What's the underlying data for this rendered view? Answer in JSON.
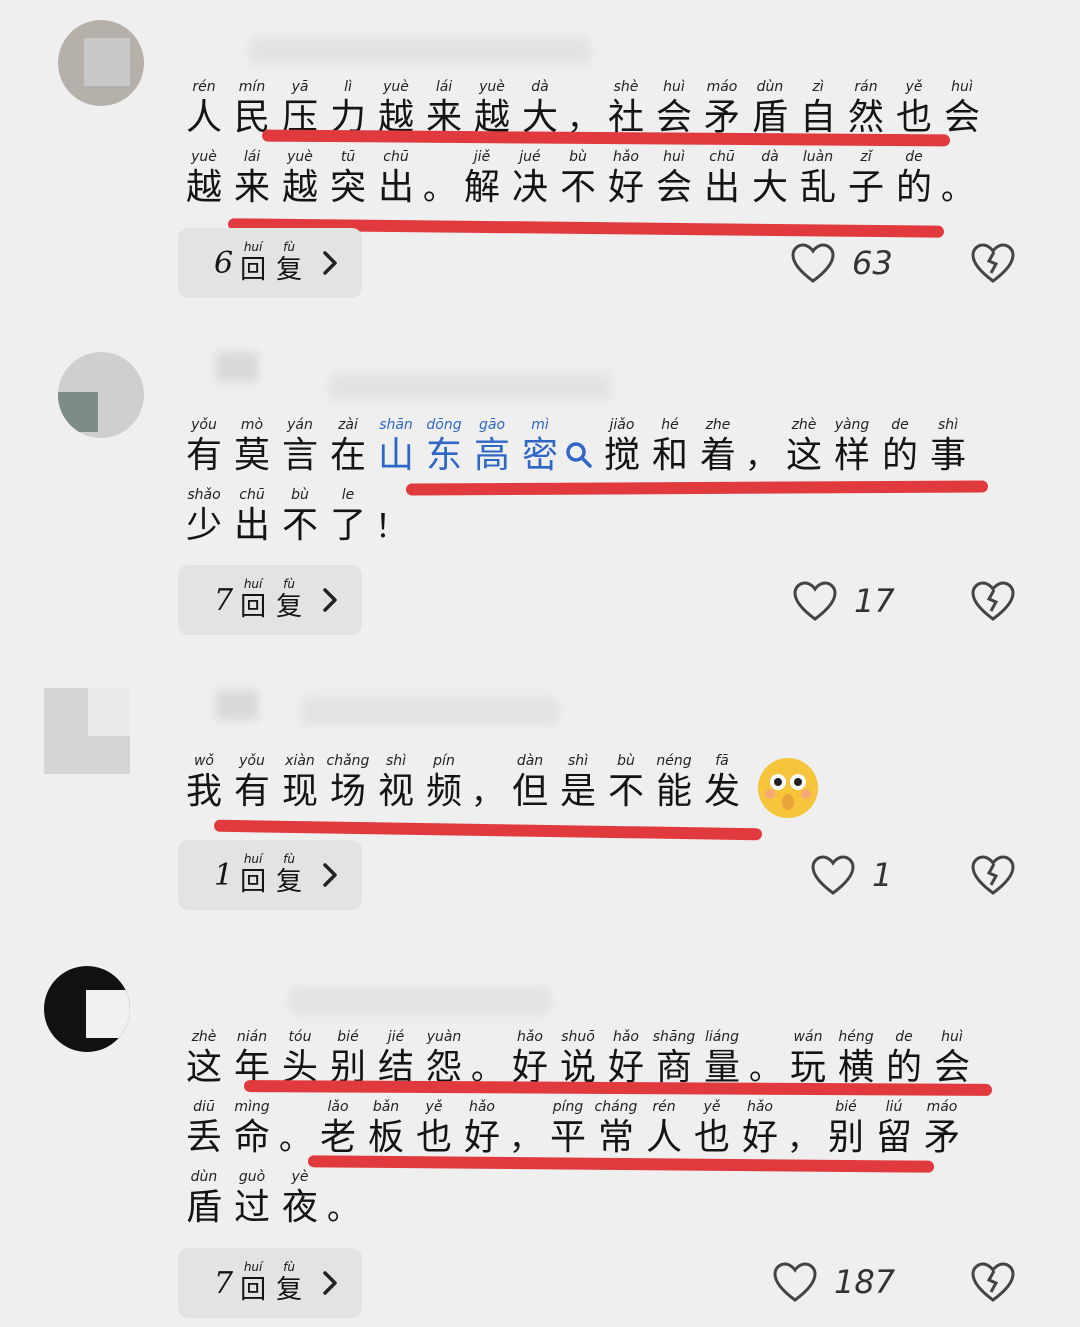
{
  "colors": {
    "background": "#efefef",
    "underline": "#e03a3e",
    "link": "#2f67c6",
    "reply_bg": "#e3e3e3"
  },
  "comments": [
    {
      "lines": [
        [
          [
            "人",
            "rén"
          ],
          [
            "民",
            "mín"
          ],
          [
            "压",
            "yā"
          ],
          [
            "力",
            "lì"
          ],
          [
            "越",
            "yuè"
          ],
          [
            "来",
            "lái"
          ],
          [
            "越",
            "yuè"
          ],
          [
            "大",
            "dà"
          ],
          [
            "，",
            ""
          ],
          [
            "社",
            "shè"
          ],
          [
            "会",
            "huì"
          ],
          [
            "矛",
            "máo"
          ],
          [
            "盾",
            "dùn"
          ],
          [
            "自",
            "zì"
          ],
          [
            "然",
            "rán"
          ],
          [
            "也",
            "yě"
          ],
          [
            "会",
            "huì"
          ]
        ],
        [
          [
            "越",
            "yuè"
          ],
          [
            "来",
            "lái"
          ],
          [
            "越",
            "yuè"
          ],
          [
            "突",
            "tū"
          ],
          [
            "出",
            "chū"
          ],
          [
            "。",
            ""
          ],
          [
            "解",
            "jiě"
          ],
          [
            "决",
            "jué"
          ],
          [
            "不",
            "bù"
          ],
          [
            "好",
            "hǎo"
          ],
          [
            "会",
            "huì"
          ],
          [
            "出",
            "chū"
          ],
          [
            "大",
            "dà"
          ],
          [
            "乱",
            "luàn"
          ],
          [
            "子",
            "zǐ"
          ],
          [
            "的",
            "de"
          ],
          [
            "。",
            ""
          ]
        ]
      ],
      "reply_count": "6",
      "reply_label": [
        [
          "回",
          "huí"
        ],
        [
          "复",
          "fù"
        ]
      ],
      "likes": "63"
    },
    {
      "lines": [
        [
          [
            "有",
            "yǒu"
          ],
          [
            "莫",
            "mò"
          ],
          [
            "言",
            "yán"
          ],
          [
            "在",
            "zài"
          ],
          [
            "山",
            "shān",
            "link"
          ],
          [
            "东",
            "dōng",
            "link"
          ],
          [
            "高",
            "gāo",
            "link"
          ],
          [
            "密",
            "mì",
            "link"
          ],
          [
            "search",
            ""
          ],
          [
            "搅",
            "jiǎo"
          ],
          [
            "和",
            "hé"
          ],
          [
            "着",
            "zhe"
          ],
          [
            "，",
            ""
          ],
          [
            "这",
            "zhè"
          ],
          [
            "样",
            "yàng"
          ],
          [
            "的",
            "de"
          ],
          [
            "事",
            "shì"
          ]
        ],
        [
          [
            "少",
            "shǎo"
          ],
          [
            "出",
            "chū"
          ],
          [
            "不",
            "bù"
          ],
          [
            "了",
            "le"
          ],
          [
            "！",
            ""
          ]
        ]
      ],
      "reply_count": "7",
      "reply_label": [
        [
          "回",
          "huí"
        ],
        [
          "复",
          "fù"
        ]
      ],
      "likes": "17"
    },
    {
      "lines": [
        [
          [
            "我",
            "wǒ"
          ],
          [
            "有",
            "yǒu"
          ],
          [
            "现",
            "xiàn"
          ],
          [
            "场",
            "chǎng"
          ],
          [
            "视",
            "shì"
          ],
          [
            "频",
            "pín"
          ],
          [
            "，",
            ""
          ],
          [
            "但",
            "dàn"
          ],
          [
            "是",
            "shì"
          ],
          [
            "不",
            "bù"
          ],
          [
            "能",
            "néng"
          ],
          [
            "发",
            "fā"
          ],
          [
            "emoji",
            ""
          ]
        ]
      ],
      "reply_count": "1",
      "reply_label": [
        [
          "回",
          "huí"
        ],
        [
          "复",
          "fù"
        ]
      ],
      "likes": "1"
    },
    {
      "lines": [
        [
          [
            "这",
            "zhè"
          ],
          [
            "年",
            "nián"
          ],
          [
            "头",
            "tóu"
          ],
          [
            "别",
            "bié"
          ],
          [
            "结",
            "jié"
          ],
          [
            "怨",
            "yuàn"
          ],
          [
            "。",
            ""
          ],
          [
            "好",
            "hǎo"
          ],
          [
            "说",
            "shuō"
          ],
          [
            "好",
            "hǎo"
          ],
          [
            "商",
            "shāng"
          ],
          [
            "量",
            "liáng"
          ],
          [
            "。",
            ""
          ],
          [
            "玩",
            "wán"
          ],
          [
            "横",
            "héng"
          ],
          [
            "的",
            "de"
          ],
          [
            "会",
            "huì"
          ]
        ],
        [
          [
            "丢",
            "diū"
          ],
          [
            "命",
            "mìng"
          ],
          [
            "。",
            ""
          ],
          [
            "老",
            "lǎo"
          ],
          [
            "板",
            "bǎn"
          ],
          [
            "也",
            "yě"
          ],
          [
            "好",
            "hǎo"
          ],
          [
            "，",
            ""
          ],
          [
            "平",
            "píng"
          ],
          [
            "常",
            "cháng"
          ],
          [
            "人",
            "rén"
          ],
          [
            "也",
            "yě"
          ],
          [
            "好",
            "hǎo"
          ],
          [
            "，",
            ""
          ],
          [
            "别",
            "bié"
          ],
          [
            "留",
            "liú"
          ],
          [
            "矛",
            "máo"
          ]
        ],
        [
          [
            "盾",
            "dùn"
          ],
          [
            "过",
            "guò"
          ],
          [
            "夜",
            "yè"
          ],
          [
            "。",
            ""
          ]
        ]
      ],
      "reply_count": "7",
      "reply_label": [
        [
          "回",
          "huí"
        ],
        [
          "复",
          "fù"
        ]
      ],
      "likes": "187"
    }
  ]
}
